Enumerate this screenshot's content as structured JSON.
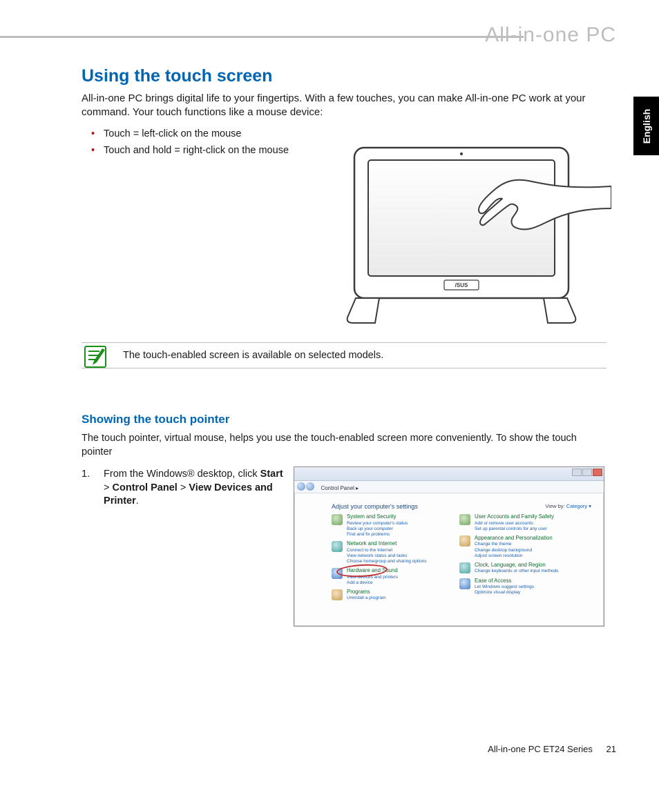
{
  "header": {
    "product_line": "All-in-one PC"
  },
  "language_tab": "English",
  "section": {
    "title": "Using the touch screen",
    "intro": "All-in-one PC brings digital life to your fingertips. With a few touches, you can make All-in-one PC work at your command. Your touch functions like a mouse device:",
    "bullets": [
      "Touch = left-click on the mouse",
      "Touch and hold = right-click on the mouse"
    ]
  },
  "note": {
    "text": "The touch-enabled screen is available on selected models."
  },
  "subsection": {
    "title": "Showing the touch pointer",
    "intro": "The touch pointer, virtual mouse, helps you use the touch-enabled screen more conveniently. To show the touch pointer",
    "step1_prefix": "From the Windows® desktop, click ",
    "step1_b1": "Start",
    "step1_sep1": " > ",
    "step1_b2": "Control Panel",
    "step1_sep2": " > ",
    "step1_b3": "View Devices and Printer",
    "step1_suffix": "."
  },
  "control_panel": {
    "breadcrumb": "Control Panel ▸",
    "adjust": "Adjust your computer's settings",
    "view_by_label": "View by:",
    "view_by_value": "Category ▾",
    "left": [
      {
        "title": "System and Security",
        "subs": [
          "Review your computer's status",
          "Back up your computer",
          "Find and fix problems"
        ],
        "ico": "green"
      },
      {
        "title": "Network and Internet",
        "subs": [
          "Connect to the Internet",
          "View network status and tasks",
          "Choose homegroup and sharing options"
        ],
        "ico": "teal"
      },
      {
        "title": "Hardware and Sound",
        "subs": [
          "View devices and printers",
          "Add a device"
        ],
        "ico": "blue"
      },
      {
        "title": "Programs",
        "subs": [
          "Uninstall a program"
        ],
        "ico": "orange"
      }
    ],
    "right": [
      {
        "title": "User Accounts and Family Safety",
        "subs": [
          "Add or remove user accounts",
          "Set up parental controls for any user"
        ],
        "ico": "green"
      },
      {
        "title": "Appearance and Personalization",
        "subs": [
          "Change the theme",
          "Change desktop background",
          "Adjust screen resolution"
        ],
        "ico": "orange"
      },
      {
        "title": "Clock, Language, and Region",
        "subs": [
          "Change keyboards or other input methods"
        ],
        "ico": "teal"
      },
      {
        "title": "Ease of Access",
        "subs": [
          "Let Windows suggest settings",
          "Optimize visual display"
        ],
        "ico": "blue"
      }
    ]
  },
  "footer": {
    "model": "All-in-one PC ET24 Series",
    "page": "21"
  }
}
